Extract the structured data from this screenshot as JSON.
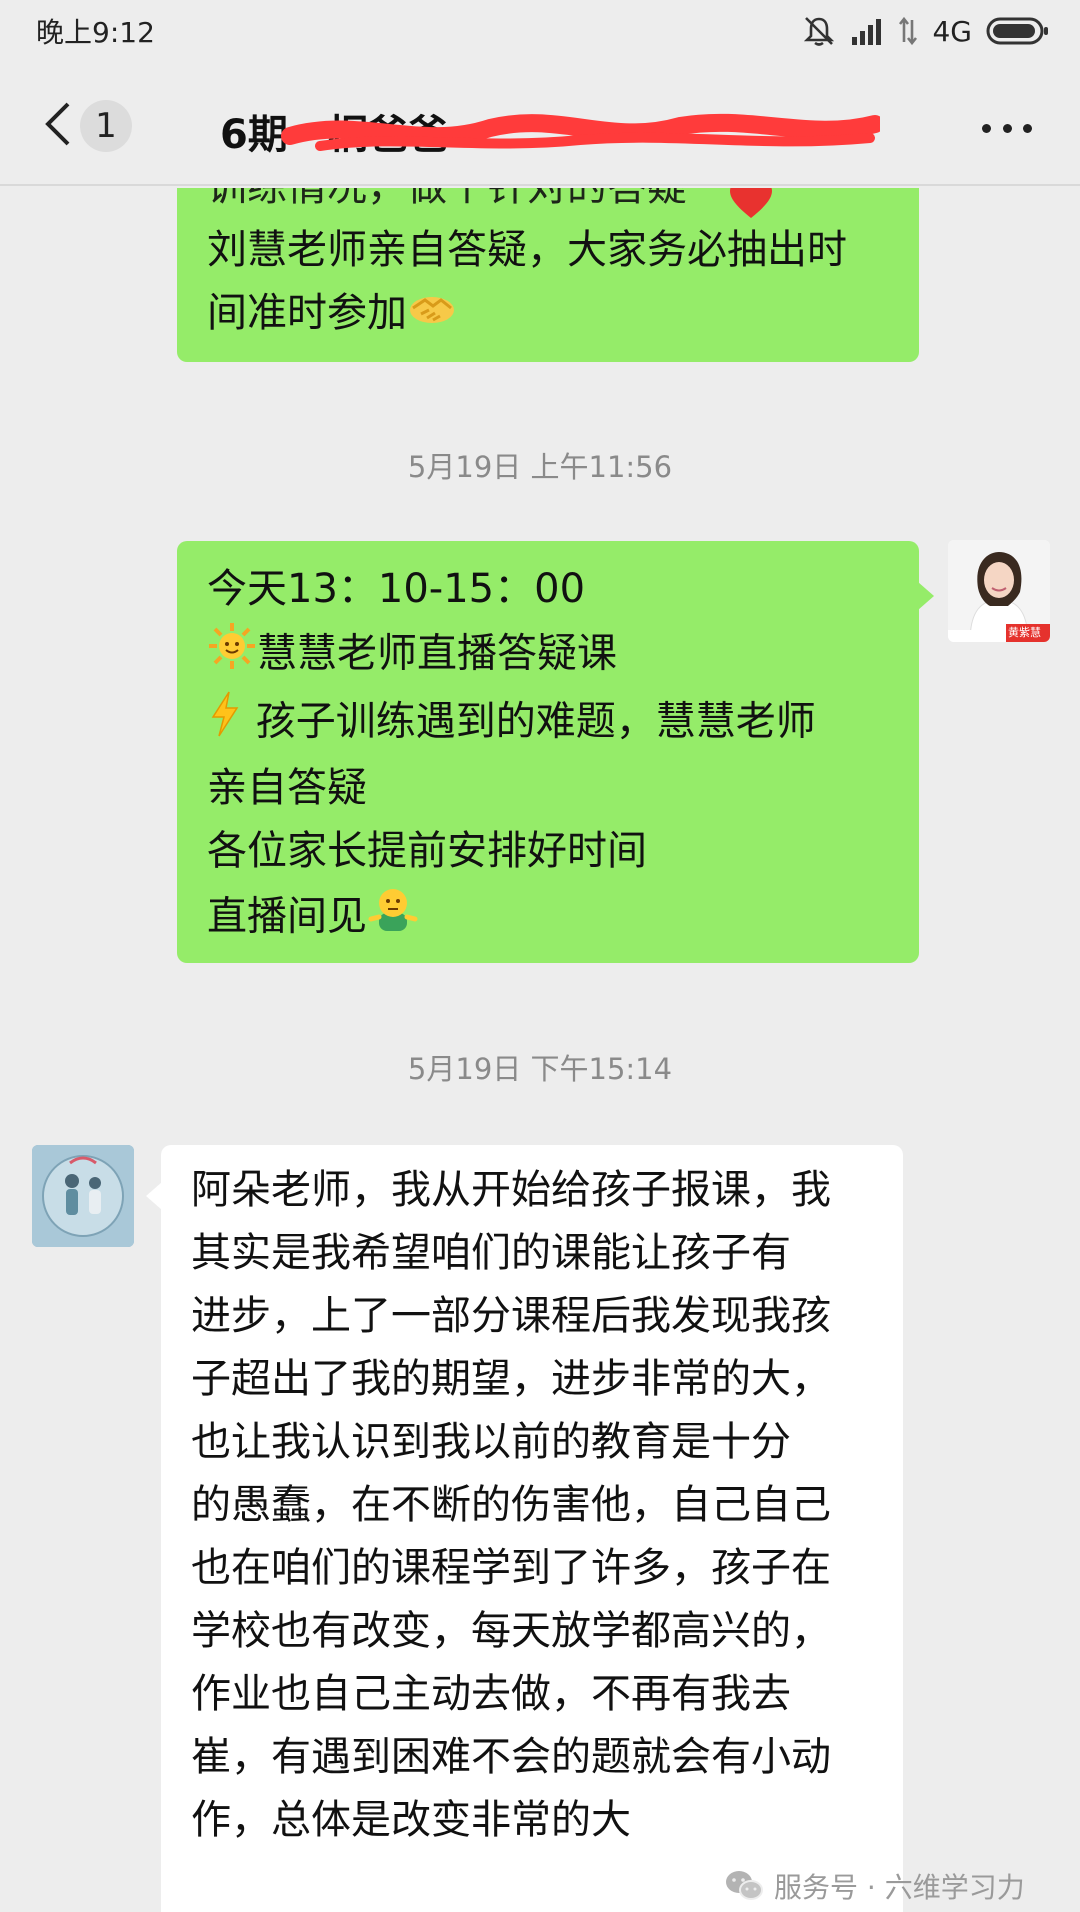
{
  "status_bar": {
    "time": "晚上9:12",
    "network": "4G"
  },
  "header": {
    "unread_count": "1",
    "title": "6期",
    "title_tail": "桐爸爸"
  },
  "messages": [
    {
      "from": "self",
      "lines": [
        "训练情况，做个针对的答疑",
        "刘慧老师亲自答疑，大家务必抽出时",
        "间准时参加"
      ]
    },
    {
      "from": "self",
      "timestamp": "5月19日 上午11:56",
      "sender_tag": "黄紫慧",
      "lines": [
        "今天13：10-15：00",
        "慧慧老师直播答疑课",
        "孩子训练遇到的难题，慧慧老师",
        "亲自答疑",
        "各位家长提前安排好时间",
        "直播间见"
      ]
    },
    {
      "from": "other",
      "timestamp": "5月19日 下午15:14",
      "lines": [
        "阿朵老师，我从开始给孩子报课，我",
        "其实是我希望咱们的课能让孩子有",
        "进步，上了一部分课程后我发现我孩",
        "子超出了我的期望，进步非常的大，",
        "也让我认识到我以前的教育是十分",
        "的愚蠢，在不断的伤害他，自己自己",
        "也在咱们的课程学到了许多，孩子在",
        "学校也有改变，每天放学都高兴的，",
        "作业也自己主动去做，不再有我去",
        "崔，有遇到困难不会的题就会有小动",
        "作，总体是改变非常的大"
      ]
    }
  ],
  "watermark": "服务号 · 六维学习力",
  "colors": {
    "self_bubble": "#95ec69",
    "other_bubble": "#ffffff",
    "background": "#ededed"
  },
  "icons": [
    "back-chevron-icon",
    "more-icon",
    "mute-icon",
    "signal-icon",
    "battery-icon",
    "wechat-icon"
  ]
}
